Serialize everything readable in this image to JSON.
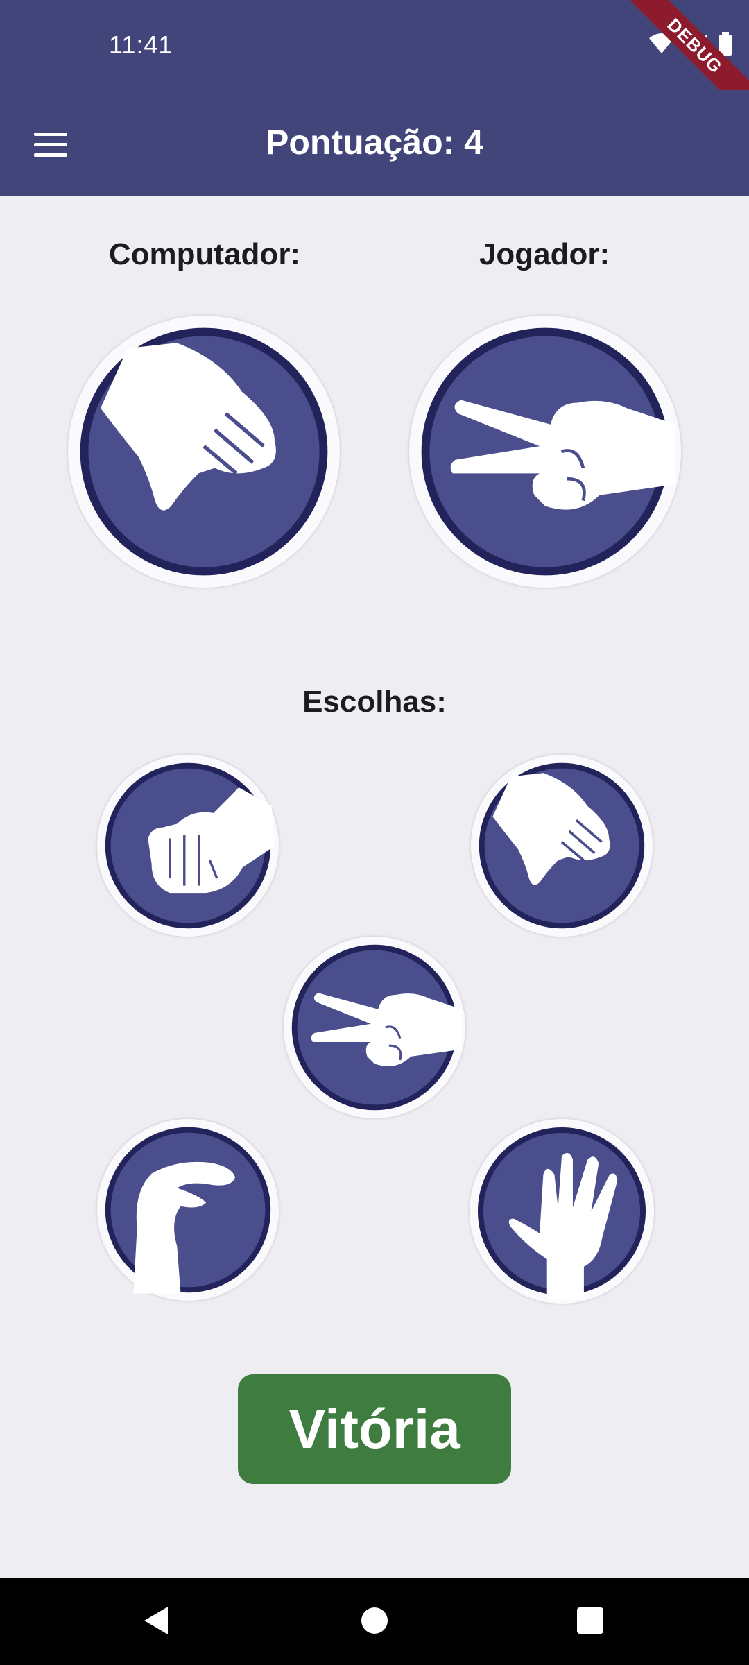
{
  "colors": {
    "primary": "#42457a",
    "disc": "#4a4e8c",
    "ring": "#22235a",
    "success": "#3f7c3f"
  },
  "status_bar": {
    "time": "11:41",
    "debug_label": "DEBUG"
  },
  "app_bar": {
    "title": "Pontuação: 4",
    "menu_icon": "hamburger-menu-icon"
  },
  "board": {
    "computer_label": "Computador:",
    "player_label": "Jogador:",
    "computer_choice": "paper",
    "player_choice": "scissors"
  },
  "choices": {
    "label": "Escolhas:",
    "options": [
      "rock",
      "paper",
      "scissors",
      "lizard",
      "spock"
    ]
  },
  "result": {
    "label": "Vitória"
  },
  "nav": {
    "back_icon": "back-triangle-icon",
    "home_icon": "home-circle-icon",
    "recents_icon": "recents-square-icon"
  }
}
